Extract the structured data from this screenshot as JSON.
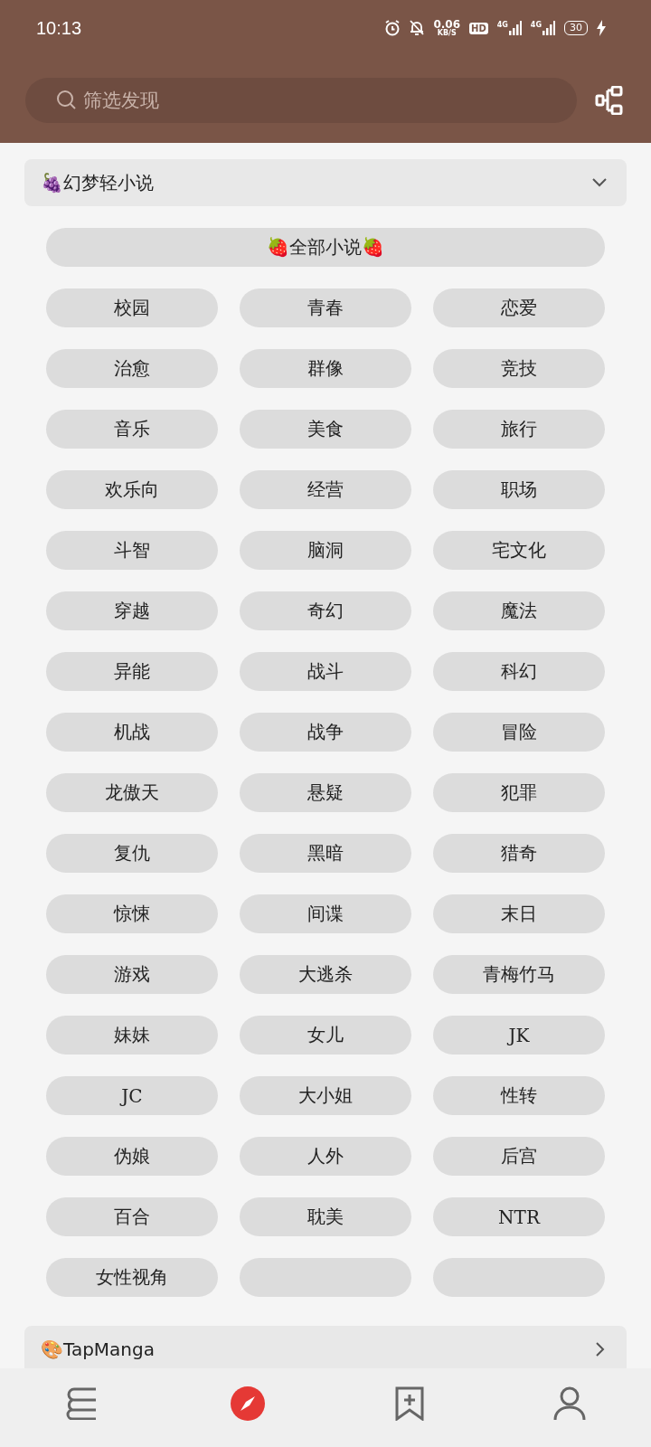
{
  "status_bar": {
    "time": "10:13",
    "net_speed": "0.06",
    "net_unit": "KB/S",
    "hd": "HD",
    "signal_1": "4G",
    "signal_2": "4G",
    "battery": "30"
  },
  "search": {
    "placeholder": "筛选发现"
  },
  "sections": [
    {
      "title": "🍇幻梦轻小说",
      "expanded": true,
      "all_label": "🍓全部小说🍓",
      "tags": [
        {
          "kind": "tag",
          "label": "校园"
        },
        {
          "kind": "tag",
          "label": "青春"
        },
        {
          "kind": "tag",
          "label": "恋爱"
        },
        {
          "kind": "tag",
          "label": "治愈"
        },
        {
          "kind": "tag",
          "label": "群像"
        },
        {
          "kind": "tag",
          "label": "竞技"
        },
        {
          "kind": "tag",
          "label": "音乐"
        },
        {
          "kind": "tag",
          "label": "美食"
        },
        {
          "kind": "tag",
          "label": "旅行"
        },
        {
          "kind": "tag",
          "label": "欢乐向"
        },
        {
          "kind": "tag",
          "label": "经营"
        },
        {
          "kind": "tag",
          "label": "职场"
        },
        {
          "kind": "tag",
          "label": "斗智"
        },
        {
          "kind": "tag",
          "label": "脑洞"
        },
        {
          "kind": "tag",
          "label": "宅文化"
        },
        {
          "kind": "tag",
          "label": "穿越"
        },
        {
          "kind": "tag",
          "label": "奇幻"
        },
        {
          "kind": "tag",
          "label": "魔法"
        },
        {
          "kind": "tag",
          "label": "异能"
        },
        {
          "kind": "tag",
          "label": "战斗"
        },
        {
          "kind": "tag",
          "label": "科幻"
        },
        {
          "kind": "tag",
          "label": "机战"
        },
        {
          "kind": "tag",
          "label": "战争"
        },
        {
          "kind": "tag",
          "label": "冒险"
        },
        {
          "kind": "tag",
          "label": "龙傲天"
        },
        {
          "kind": "tag",
          "label": "悬疑"
        },
        {
          "kind": "tag",
          "label": "犯罪"
        },
        {
          "kind": "tag",
          "label": "复仇"
        },
        {
          "kind": "tag",
          "label": "黑暗"
        },
        {
          "kind": "tag",
          "label": "猎奇"
        },
        {
          "kind": "tag",
          "label": "惊悚"
        },
        {
          "kind": "tag",
          "label": "间谍"
        },
        {
          "kind": "tag",
          "label": "末日"
        },
        {
          "kind": "tag",
          "label": "游戏"
        },
        {
          "kind": "tag",
          "label": "大逃杀"
        },
        {
          "kind": "tag",
          "label": "青梅竹马"
        },
        {
          "kind": "tag",
          "label": "妹妹"
        },
        {
          "kind": "tag",
          "label": "女儿"
        },
        {
          "kind": "tag",
          "label": "JK"
        },
        {
          "kind": "tag",
          "label": "JC"
        },
        {
          "kind": "tag",
          "label": "大小姐"
        },
        {
          "kind": "tag",
          "label": "性转"
        },
        {
          "kind": "tag",
          "label": "伪娘"
        },
        {
          "kind": "tag",
          "label": "人外"
        },
        {
          "kind": "tag",
          "label": "后宫"
        },
        {
          "kind": "tag",
          "label": "百合"
        },
        {
          "kind": "tag",
          "label": "耽美"
        },
        {
          "kind": "tag",
          "label": "NTR"
        },
        {
          "kind": "tag",
          "label": "女性视角"
        },
        {
          "kind": "blank"
        },
        {
          "kind": "blank"
        }
      ]
    },
    {
      "title": "🎨TapManga",
      "expanded": false
    }
  ],
  "bottom_nav": [
    {
      "kind": "bookshelf",
      "selected": false
    },
    {
      "kind": "discover",
      "selected": true
    },
    {
      "kind": "bookmark",
      "selected": false
    },
    {
      "kind": "profile",
      "selected": false
    }
  ]
}
